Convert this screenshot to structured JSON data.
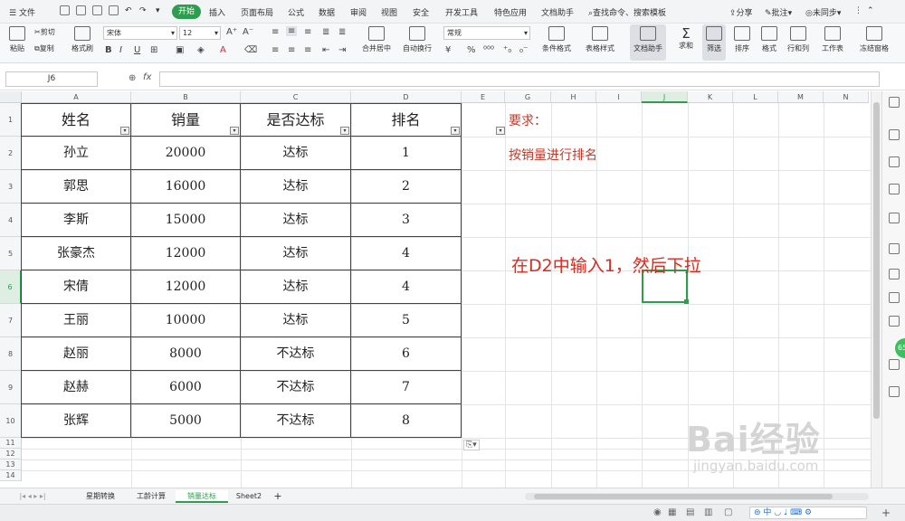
{
  "menu": {
    "file": "文件",
    "start": "开始",
    "items": [
      "插入",
      "页面布局",
      "公式",
      "数据",
      "审阅",
      "视图",
      "安全",
      "开发工具",
      "特色应用",
      "文档助手"
    ],
    "search": "查找命令、搜索模板",
    "share": "分享",
    "comment": "批注",
    "sync": "未同步"
  },
  "ribbon": {
    "paste": "粘贴",
    "cut": "剪切",
    "copy": "复制",
    "format_painter": "格式刷",
    "font_name": "宋体",
    "font_size": "12",
    "bold": "B",
    "italic": "I",
    "underline": "U",
    "merge": "合并居中",
    "wrap": "自动换行",
    "number_format": "常规",
    "currency": "¥",
    "percent": "%",
    "cond_format": "条件格式",
    "table_style": "表格样式",
    "doc_helper": "文档助手",
    "sum": "求和",
    "filter": "筛选",
    "sort": "排序",
    "format": "格式",
    "rowcol": "行和列",
    "worksheet": "工作表",
    "freeze": "冻结窗格"
  },
  "formula_bar": {
    "name_box": "J6",
    "fx": "fx",
    "formula": ""
  },
  "columns": [
    "A",
    "B",
    "C",
    "D",
    "E",
    "G",
    "H",
    "I",
    "J",
    "K",
    "L",
    "M",
    "N"
  ],
  "rows": [
    "1",
    "2",
    "3",
    "4",
    "5",
    "6",
    "7",
    "8",
    "9",
    "10",
    "11",
    "12",
    "13",
    "14"
  ],
  "table": {
    "headers": [
      "姓名",
      "销量",
      "是否达标",
      "排名"
    ],
    "rows": [
      [
        "孙立",
        "20000",
        "达标",
        "1"
      ],
      [
        "郭思",
        "16000",
        "达标",
        "2"
      ],
      [
        "李斯",
        "15000",
        "达标",
        "3"
      ],
      [
        "张豪杰",
        "12000",
        "达标",
        "4"
      ],
      [
        "宋倩",
        "12000",
        "达标",
        "4"
      ],
      [
        "王丽",
        "10000",
        "达标",
        "5"
      ],
      [
        "赵丽",
        "8000",
        "不达标",
        "6"
      ],
      [
        "赵赫",
        "6000",
        "不达标",
        "7"
      ],
      [
        "张辉",
        "5000",
        "不达标",
        "8"
      ]
    ]
  },
  "notes": {
    "req_title": "要求：",
    "req_text": "按销量进行排名",
    "instruction": "在D2中输入1，然后下拉"
  },
  "sheets": {
    "tabs": [
      "星期转换",
      "工龄计算",
      "销量达标",
      "Sheet2"
    ],
    "active": "销量达标",
    "add": "+"
  },
  "status": {
    "zoom_badge": "65",
    "ime": "中"
  },
  "watermark": {
    "main": "Bai经验",
    "sub": "jingyan.baidu.com"
  },
  "colors": {
    "accent": "#2f9d4f",
    "note_red": "#c0392b",
    "instruction_red": "#d92b1f",
    "selection": "#2f9d4f"
  }
}
